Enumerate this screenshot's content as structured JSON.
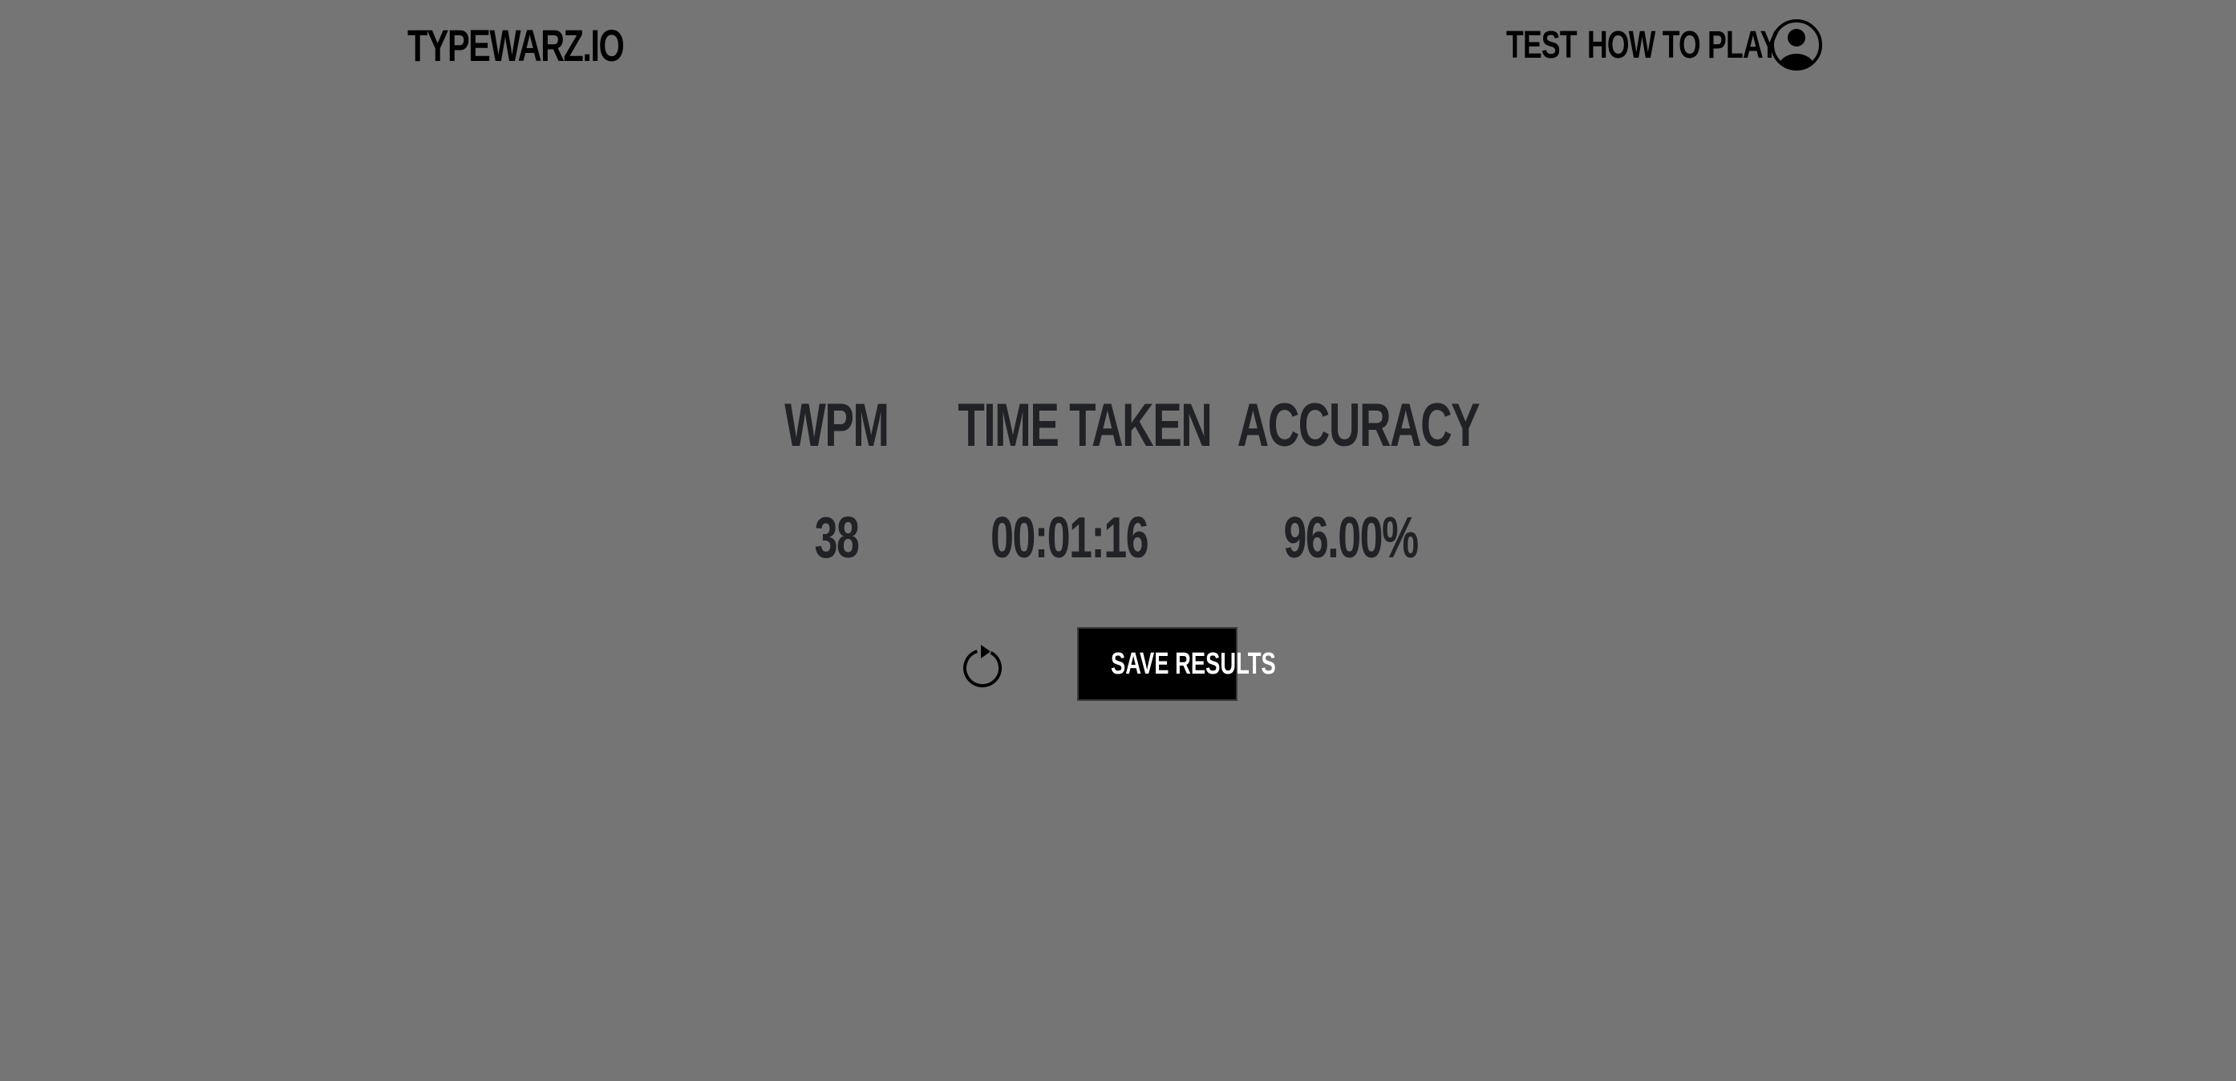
{
  "header": {
    "logo": "TYPEWARZ.IO",
    "nav": {
      "test": "TEST",
      "how_to_play": "HOW TO PLAY"
    },
    "profile_icon": "user-circle-icon"
  },
  "results": {
    "wpm": {
      "label": "WPM",
      "value": "38"
    },
    "time_taken": {
      "label": "TIME TAKEN",
      "value": "00:01:16"
    },
    "accuracy": {
      "label": "ACCURACY",
      "value": "96.00%"
    }
  },
  "actions": {
    "restart_icon": "restart-icon",
    "save_label": "SAVE RESULTS"
  },
  "colors": {
    "background": "#757575",
    "stat_text": "#212226",
    "button_bg": "#000000",
    "button_text": "#ffffff"
  }
}
